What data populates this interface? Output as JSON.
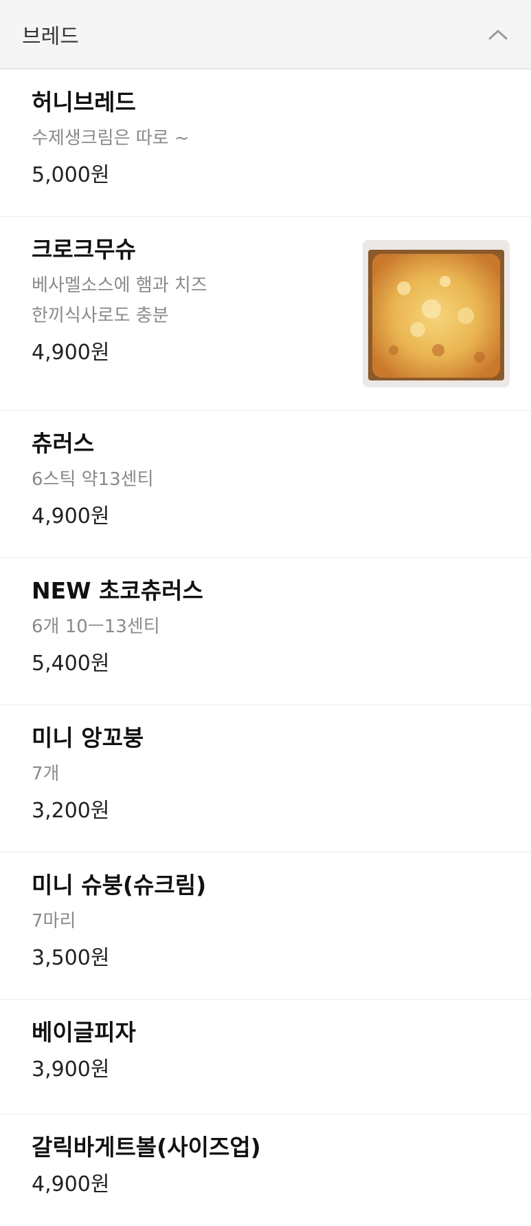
{
  "section": {
    "title": "브레드",
    "collapse_icon": "chevron-up-icon"
  },
  "items": [
    {
      "name": "허니브레드",
      "desc": [
        "수제생크림은 따로 ~"
      ],
      "price": "5,000원"
    },
    {
      "name": "크로크무슈",
      "desc": [
        "베사멜소스에 햄과 치즈",
        "한끼식사로도 충분"
      ],
      "price": "4,900원",
      "has_image": true
    },
    {
      "name": "츄러스",
      "desc": [
        "6스틱  약13센티"
      ],
      "price": "4,900원"
    },
    {
      "name": "NEW 초코츄러스",
      "desc": [
        "6개 10ㅡ13센티"
      ],
      "price": "5,400원"
    },
    {
      "name": "미니 앙꼬붕",
      "desc": [
        "7개"
      ],
      "price": "3,200원"
    },
    {
      "name": "미니 슈붕(슈크림)",
      "desc": [
        "7마리"
      ],
      "price": "3,500원"
    },
    {
      "name": "베이글피자",
      "desc": [],
      "price": "3,900원"
    },
    {
      "name": "갈릭바게트볼(사이즈업)",
      "desc": [],
      "price": "4,900원"
    }
  ],
  "colors": {
    "header_bg": "#f5f5f5",
    "desc_text": "#8a8a8a",
    "divider": "#ececec"
  }
}
